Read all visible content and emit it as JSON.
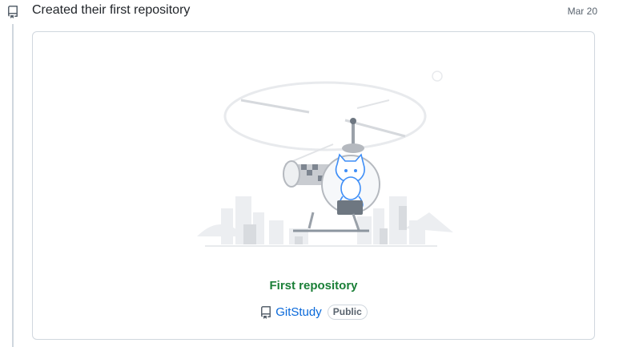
{
  "event": {
    "icon": "repo-icon",
    "title": "Created their first repository",
    "date": "Mar 20"
  },
  "card": {
    "illustration": "octocat-helicopter-illustration",
    "heading": "First repository",
    "repo": {
      "icon": "repo-icon",
      "name": "GitStudy",
      "visibility": "Public"
    }
  },
  "colors": {
    "heading": "#1a7f37",
    "link": "#0969da",
    "muted": "#59636e",
    "border": "#d0d7de"
  }
}
